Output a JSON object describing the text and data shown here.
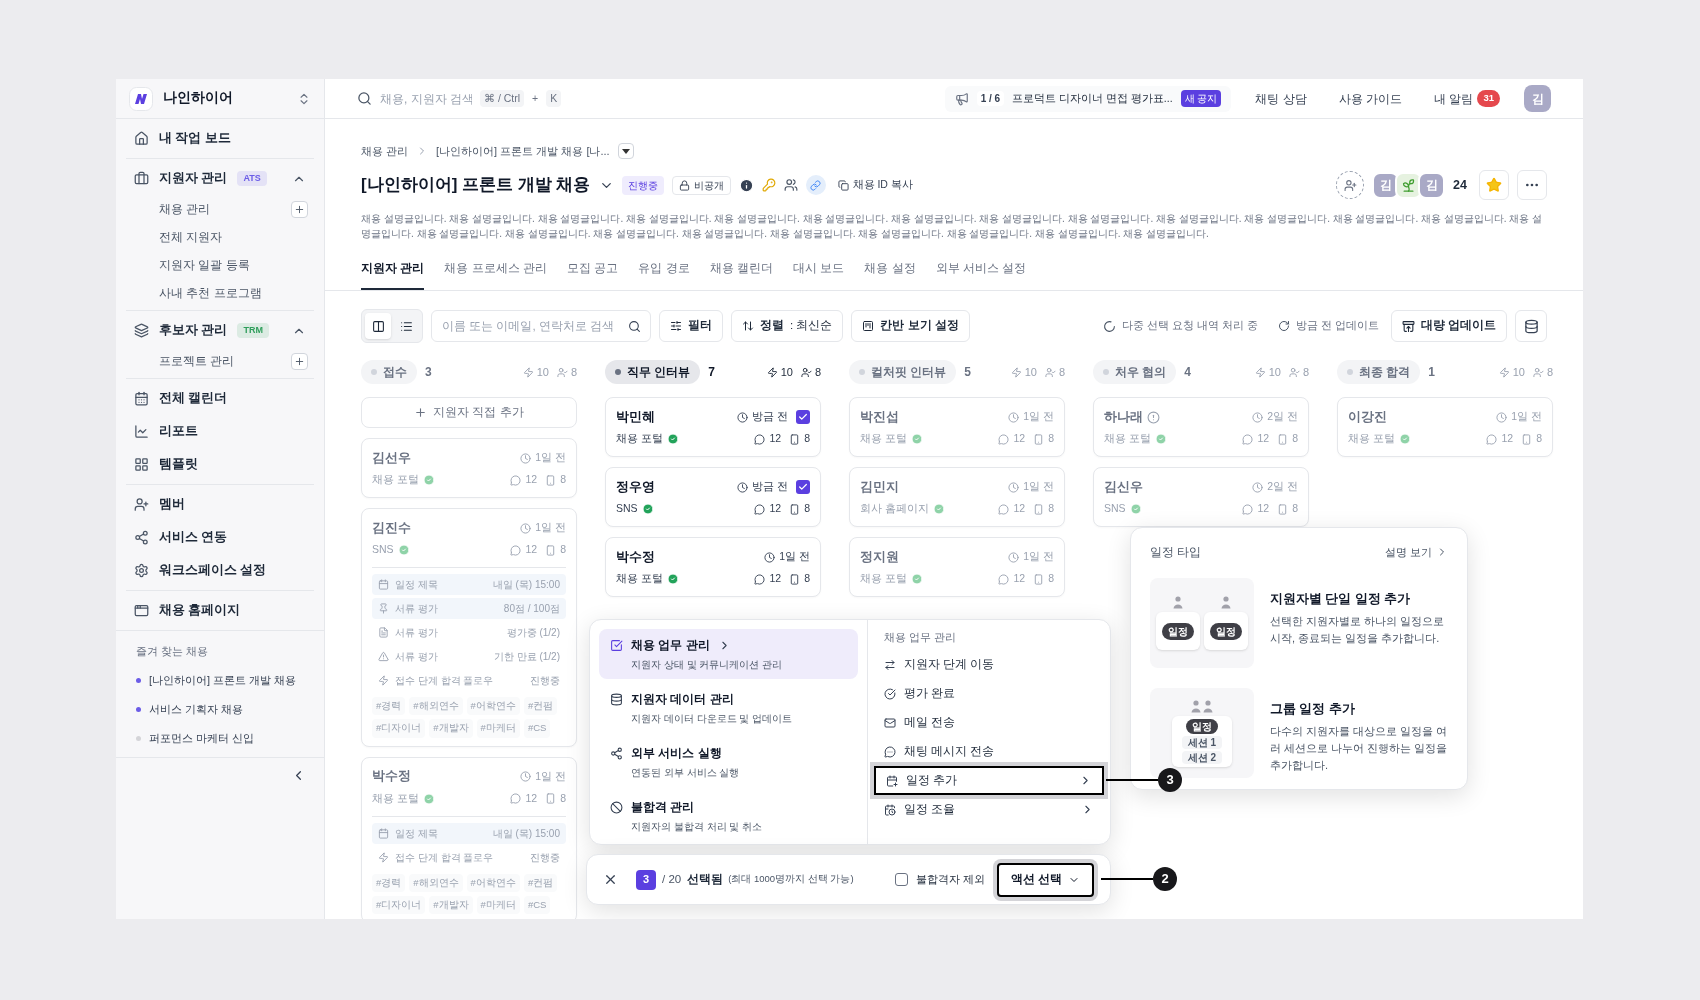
{
  "workspace": {
    "name": "나인하이어"
  },
  "sidebar": {
    "groups": [
      [
        {
          "label": "내 작업 보드"
        }
      ],
      [
        {
          "label": "지원자 관리",
          "badge": {
            "text": "ATS",
            "color": "#6b5ce7"
          },
          "expanded": true,
          "children": [
            {
              "label": "채용 관리",
              "addable": true
            },
            {
              "label": "전체 지원자",
              "addable": false
            },
            {
              "label": "지원자 일괄 등록",
              "addable": false
            },
            {
              "label": "사내 추천 프로그램",
              "addable": false
            }
          ]
        }
      ],
      [
        {
          "label": "후보자 관리",
          "badge": {
            "text": "TRM",
            "color": "#2f9e5b"
          },
          "expanded": true,
          "children": [
            {
              "label": "프로젝트 관리",
              "addable": true
            }
          ]
        }
      ],
      [
        {
          "label": "전체 캘린더"
        },
        {
          "label": "리포트"
        },
        {
          "label": "템플릿"
        }
      ],
      [
        {
          "label": "멤버"
        },
        {
          "label": "서비스 연동"
        },
        {
          "label": "워크스페이스 설정"
        }
      ],
      [
        {
          "label": "채용 홈페이지"
        }
      ]
    ],
    "favorites": {
      "title": "즐겨 찾는 채용",
      "items": [
        {
          "label": "[나인하이어] 프론트 개발 채용",
          "color": "#6b5ce7"
        },
        {
          "label": "서비스 기획자 채용",
          "color": "#6b5ce7"
        },
        {
          "label": "퍼포먼스 마케터 신입",
          "color": "#d4d4d8"
        }
      ]
    }
  },
  "header": {
    "search": {
      "placeholder": "채용, 지원자 검색",
      "keys": [
        "⌘ / Ctrl",
        "+",
        "K"
      ]
    },
    "notice": {
      "counter": "1 / 6",
      "text": "프로덕트 디자이너 면접 평가표...",
      "badge": "새 공지"
    },
    "links": [
      "채팅 상담",
      "사용 가이드"
    ],
    "notifications": {
      "label": "내 알림",
      "count": "31"
    },
    "avatar": "김"
  },
  "breadcrumb": [
    "채용 관리",
    "[나인하이어] 프론트 개발 채용 [나..."
  ],
  "job": {
    "title": "[나인하이어] 프론트 개발 채용",
    "status": "진행중",
    "visibility": "비공개",
    "copy_label": "채용 ID 복사",
    "members": [
      {
        "kind": "letter",
        "text": "김"
      },
      {
        "kind": "sprout"
      },
      {
        "kind": "letter",
        "text": "김"
      }
    ],
    "member_count": "24",
    "starred": true,
    "description": "채용 설명글입니다. 채용 설명글입니다. 채용 설명글입니다. 채용 설명글입니다. 채용 설명글입니다. 채용 설명글입니다. 채용 설명글입니다. 채용 설명글입니다. 채용 설명글입니다. 채용 설명글입니다. 채용 설명글입니다. 채용 설명글입니다. 채용 설명글입니다. 채용 설명글입니다. 채용 설명글입니다. 채용 설명글입니다. 채용 설명글입니다. 채용 설명글입니다. 채용 설명글입니다. 채용 설명글입니다. 채용 설명글입니다. 채용 설명글입니다. 채용 설명글입니다."
  },
  "tabs": [
    {
      "label": "지원자 관리",
      "selected": true
    },
    {
      "label": "채용 프로세스 관리",
      "selected": false
    },
    {
      "label": "모집 공고",
      "selected": false
    },
    {
      "label": "유입 경로",
      "selected": false
    },
    {
      "label": "채용 캘린더",
      "selected": false
    },
    {
      "label": "대시 보드",
      "selected": false
    },
    {
      "label": "채용 설정",
      "selected": false
    },
    {
      "label": "외부 서비스 설정",
      "selected": false
    }
  ],
  "toolbar": {
    "views": [
      {
        "kind": "kanban",
        "selected": true
      },
      {
        "kind": "list",
        "selected": false
      }
    ],
    "search": {
      "placeholder": "이름 또는 이메일, 연락처로 검색"
    },
    "filter": "필터",
    "sort": {
      "label": "정렬",
      "value": ": 최신순"
    },
    "kanban_settings": "칸반 보기 설정",
    "processing": "다중 선택 요청 내역 처리 중",
    "updated": "방금 전 업데이트",
    "bulk_update": "대량 업데이트"
  },
  "columns": [
    {
      "name": "접수",
      "count": "3",
      "lightning_count": "10",
      "person_count": "8",
      "active": false,
      "add_label": "지원자 직접 추가",
      "cards": [
        {
          "name": "김선우",
          "alert": false,
          "time": "1일 전",
          "selected": false,
          "source": "채용 포털",
          "comments": "12",
          "files": "8"
        },
        {
          "name": "김진수",
          "alert": false,
          "time": "1일 전",
          "selected": false,
          "source": "SNS",
          "comments": "12",
          "files": "8",
          "details": [
            {
              "kind": "schedule",
              "label": "일정 제목",
              "value": "내일 (목) 15:00"
            },
            {
              "kind": "score",
              "label": "서류 평가",
              "value": "80점 / 100점"
            },
            {
              "kind": "progress",
              "label": "서류 평가",
              "value": "평가중 (1/2)"
            },
            {
              "kind": "overdue",
              "label": "서류 평가",
              "value": "기한 만료 (1/2)"
            },
            {
              "kind": "flow",
              "label": "접수 단계 합격 플로우",
              "value": "진행중"
            }
          ],
          "tags": [
            "#경력",
            "#해외연수",
            "#어학연수",
            "#컨펌",
            "#디자이너",
            "#개발자",
            "#마케터",
            "#CS"
          ]
        },
        {
          "name": "박수정",
          "alert": false,
          "time": "1일 전",
          "selected": false,
          "source": "채용 포털",
          "comments": "12",
          "files": "8",
          "details": [
            {
              "kind": "schedule",
              "label": "일정 제목",
              "value": "내일 (목) 15:00"
            },
            {
              "kind": "flow",
              "label": "접수 단계 합격 플로우",
              "value": "진행중"
            }
          ],
          "tags": [
            "#경력",
            "#해외연수",
            "#어학연수",
            "#컨펌",
            "#디자이너",
            "#개발자",
            "#마케터",
            "#CS"
          ]
        }
      ]
    },
    {
      "name": "직무 인터뷰",
      "count": "7",
      "lightning_count": "10",
      "person_count": "8",
      "active": true,
      "cards": [
        {
          "name": "박민혜",
          "alert": false,
          "time": "방금 전",
          "selected": true,
          "source": "채용 포털",
          "comments": "12",
          "files": "8"
        },
        {
          "name": "정우영",
          "alert": false,
          "time": "방금 전",
          "selected": true,
          "source": "SNS",
          "comments": "12",
          "files": "8"
        },
        {
          "name": "박수정",
          "alert": false,
          "time": "1일 전",
          "selected": false,
          "source": "채용 포털",
          "comments": "12",
          "files": "8"
        }
      ]
    },
    {
      "name": "컬처핏 인터뷰",
      "count": "5",
      "lightning_count": "10",
      "person_count": "8",
      "active": false,
      "cards": [
        {
          "name": "박진섭",
          "alert": false,
          "time": "1일 전",
          "selected": false,
          "source": "채용 포털",
          "comments": "12",
          "files": "8"
        },
        {
          "name": "김민지",
          "alert": false,
          "time": "1일 전",
          "selected": false,
          "source": "회사 홈페이지",
          "comments": "12",
          "files": "8"
        },
        {
          "name": "정지원",
          "alert": false,
          "time": "1일 전",
          "selected": false,
          "source": "채용 포털",
          "comments": "12",
          "files": "8"
        }
      ]
    },
    {
      "name": "처우 협의",
      "count": "4",
      "lightning_count": "10",
      "person_count": "8",
      "active": false,
      "cards": [
        {
          "name": "하나래",
          "alert": true,
          "time": "2일 전",
          "selected": false,
          "source": "채용 포털",
          "comments": "12",
          "files": "8"
        },
        {
          "name": "김신우",
          "alert": false,
          "time": "2일 전",
          "selected": false,
          "source": "SNS",
          "comments": "12",
          "files": "8"
        }
      ]
    },
    {
      "name": "최종 합격",
      "count": "1",
      "lightning_count": "10",
      "person_count": "8",
      "active": false,
      "cards": [
        {
          "name": "이강진",
          "alert": false,
          "time": "1일 전",
          "selected": false,
          "source": "채용 포털",
          "comments": "12",
          "files": "8"
        }
      ]
    }
  ],
  "action_menu": {
    "categories": [
      {
        "title": "채용 업무 관리",
        "description": "지원자 상태 및 커뮤니케이션 관리",
        "selected": true
      },
      {
        "title": "지원자 데이터 관리",
        "description": "지원자 데이터 다운로드 및 업데이트",
        "selected": false
      },
      {
        "title": "외부 서비스 실행",
        "description": "연동된 외부 서비스 실행",
        "selected": false
      },
      {
        "title": "불합격 관리",
        "description": "지원자의 불합격 처리 및 취소",
        "selected": false
      }
    ],
    "heading": "채용 업무 관리",
    "items": [
      {
        "label": "지원자 단계 이동",
        "submenu": false,
        "selected": false
      },
      {
        "label": "평가 완료",
        "submenu": false,
        "selected": false
      },
      {
        "label": "메일 전송",
        "submenu": false,
        "selected": false
      },
      {
        "label": "채팅 메시지 전송",
        "submenu": false,
        "selected": false
      },
      {
        "label": "일정 추가",
        "submenu": true,
        "selected": true
      },
      {
        "label": "일정 조율",
        "submenu": true,
        "selected": false
      }
    ]
  },
  "selection_bar": {
    "count": "3",
    "total": "/ 20",
    "label": "선택됨",
    "hint": "(최대 1000명까지 선택 가능)",
    "exclude": {
      "label": "불합격자 제외",
      "checked": false
    },
    "action": "액션 선택"
  },
  "schedule_popover": {
    "title": "일정 타입",
    "link": "설명 보기",
    "options": [
      {
        "kind": "single",
        "title": "지원자별 단일 일정 추가",
        "description": "선택한 지원자별로 하나의 일정으로 시작, 종료되는 일정을 추가합니다.",
        "labels": [
          "일정",
          "일정"
        ]
      },
      {
        "kind": "group",
        "title": "그룹 일정 추가",
        "description": "다수의 지원자를 대상으로 일정을 여러 세션으로 나누어 진행하는 일정을 추가합니다.",
        "labels": [
          "일정",
          "세션 1",
          "세션 2"
        ]
      }
    ]
  },
  "callouts": [
    "3",
    "2"
  ]
}
